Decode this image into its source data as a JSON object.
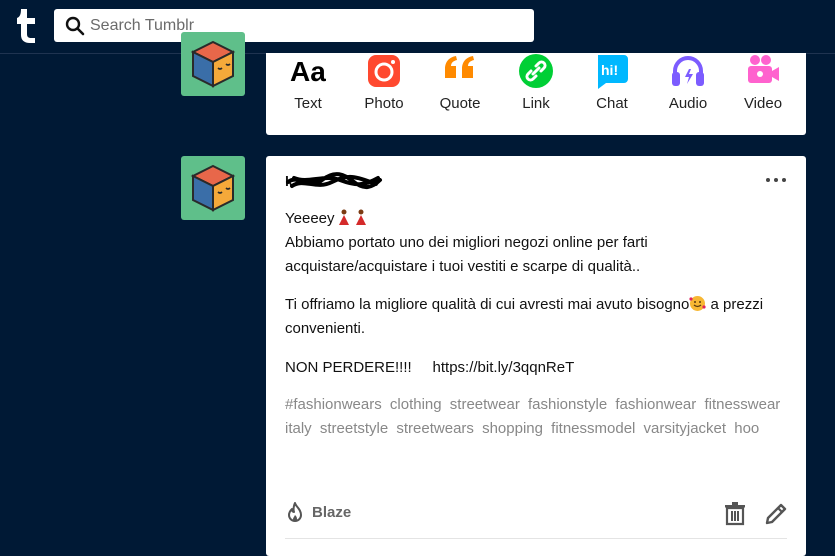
{
  "search": {
    "placeholder": "Search Tumblr"
  },
  "composer": {
    "types": [
      {
        "label": "Text",
        "icon": "text-icon"
      },
      {
        "label": "Photo",
        "icon": "camera-icon"
      },
      {
        "label": "Quote",
        "icon": "quote-icon"
      },
      {
        "label": "Link",
        "icon": "link-icon"
      },
      {
        "label": "Chat",
        "icon": "chat-icon"
      },
      {
        "label": "Audio",
        "icon": "headphones-icon"
      },
      {
        "label": "Video",
        "icon": "video-camera-icon"
      }
    ]
  },
  "post": {
    "username": "k",
    "line1": "Yeeeey",
    "line2": "Abbiamo portato uno dei migliori negozi online per farti acquistare/acquistare i tuoi vestiti e scarpe di qualità..",
    "line3a": "Ti offriamo la migliore qualità di cui avresti mai avuto bisogno",
    "line3b": "a prezzi convenienti.",
    "line4": "NON PERDERE!!!!",
    "link": "https://bit.ly/3qqnReT",
    "tags": [
      "#fashionwears",
      "clothing",
      "streetwear",
      "fashionstyle",
      "fashionwear",
      "fitnesswear",
      "italy",
      "streetstyle",
      "streetwears",
      "shopping",
      "fitnessmodel",
      "varsityjacket",
      "hoo"
    ],
    "blaze_label": "Blaze"
  },
  "colors": {
    "background": "#001935",
    "photo": "#ff492f",
    "quote": "#ff8a00",
    "link": "#00cf35",
    "chat": "#00b8ff",
    "audio": "#7c5cff",
    "video": "#ff62ce",
    "avatar_bg": "#5fbf8a"
  }
}
